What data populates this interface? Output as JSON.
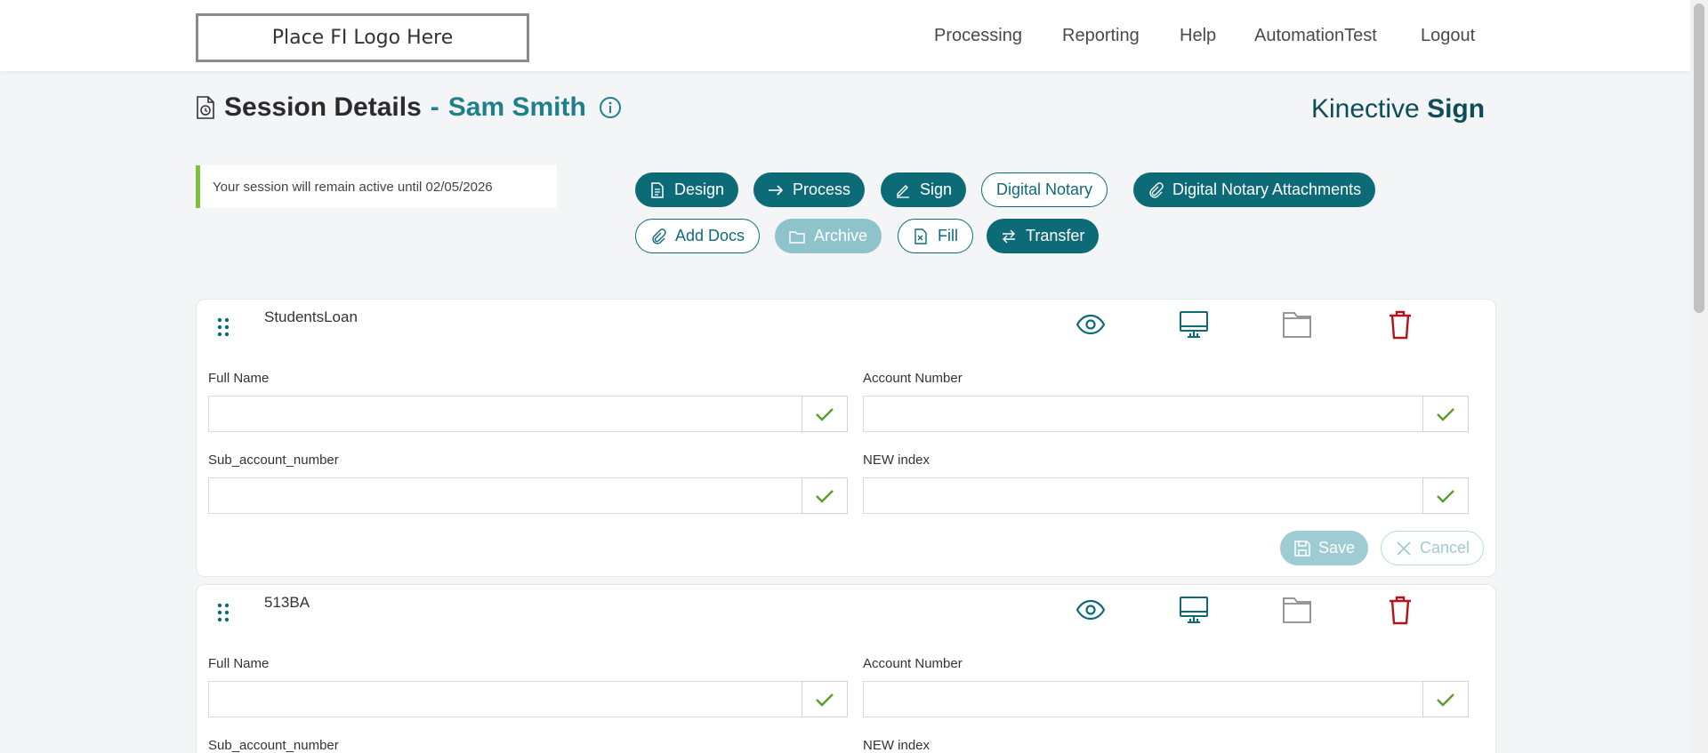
{
  "header": {
    "logo_text": "Place FI Logo Here",
    "nav": [
      "Processing",
      "Reporting",
      "Help",
      "AutomationTest",
      "Logout"
    ]
  },
  "page": {
    "title": "Session Details",
    "dash": "-",
    "user_name": "Sam Smith",
    "brand_light": "Kinective",
    "brand_bold": "Sign",
    "session_note": "Your session will remain active until 02/05/2026"
  },
  "toolbar": {
    "design": "Design",
    "process": "Process",
    "sign": "Sign",
    "digital_notary": "Digital Notary",
    "digital_notary_attachments": "Digital Notary Attachments",
    "add_docs": "Add Docs",
    "archive": "Archive",
    "fill": "Fill",
    "transfer": "Transfer"
  },
  "documents": [
    {
      "name": "StudentsLoan",
      "fields": {
        "full_name": "Full Name",
        "account_number": "Account Number",
        "sub_account_number": "Sub_account_number",
        "new_index": "NEW index"
      },
      "save_label": "Save",
      "cancel_label": "Cancel"
    },
    {
      "name": "513BA",
      "fields": {
        "full_name": "Full Name",
        "account_number": "Account Number",
        "sub_account_number": "Sub_account_number",
        "new_index": "NEW index"
      }
    }
  ],
  "colors": {
    "primary": "#0d6b78",
    "accent_green": "#7ac142",
    "delete_red": "#b3121a",
    "disabled": "#9fcbd2"
  }
}
